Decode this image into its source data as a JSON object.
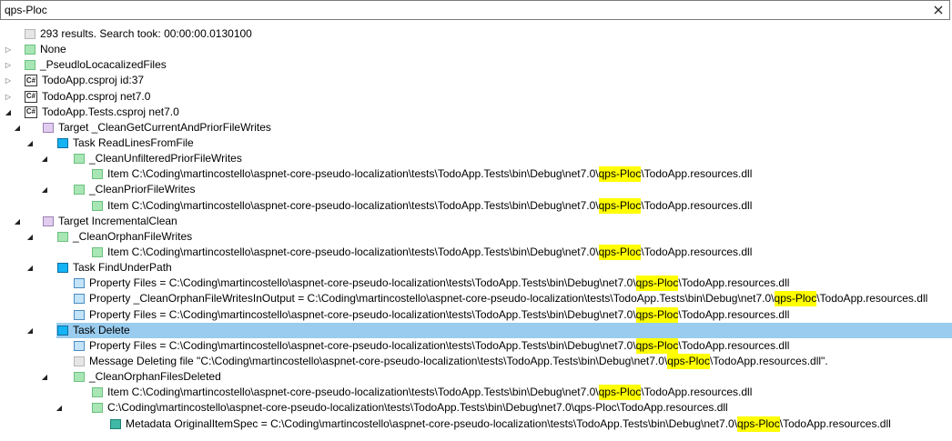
{
  "search": {
    "value": "qps-Ploc",
    "placeholder": ""
  },
  "tree": [
    {
      "level": 0,
      "toggle": "none",
      "icon": "message",
      "name": "summary-message",
      "text": "293 results. Search took: 00:00:00.0130100"
    },
    {
      "level": 0,
      "toggle": "closed",
      "icon": "folder",
      "name": "folder-none",
      "text": "None"
    },
    {
      "level": 0,
      "toggle": "closed",
      "icon": "folder",
      "name": "folder-pseudolocalized-files",
      "text": "_PseudloLocacalizedFiles"
    },
    {
      "level": 0,
      "toggle": "closed",
      "icon": "csharp",
      "name": "project-todoapp-id37",
      "text": "TodoApp.csproj id:37"
    },
    {
      "level": 0,
      "toggle": "closed",
      "icon": "csharp",
      "name": "project-todoapp-net70",
      "text": "TodoApp.csproj net7.0"
    },
    {
      "level": 0,
      "toggle": "open",
      "icon": "csharp",
      "name": "project-todoapp-tests",
      "text": "TodoApp.Tests.csproj net7.0"
    },
    {
      "level": 1,
      "toggle": "open",
      "icon": "target",
      "name": "target-clean-get-current",
      "text": "Target _CleanGetCurrentAndPriorFileWrites"
    },
    {
      "level": 2,
      "toggle": "open",
      "icon": "task",
      "name": "task-readlinesfromfile",
      "text": "Task ReadLinesFromFile"
    },
    {
      "level": 3,
      "toggle": "open",
      "icon": "folder",
      "name": "folder-clean-unfiltered",
      "text": "_CleanUnfilteredPriorFileWrites"
    },
    {
      "level": 4,
      "toggle": "none",
      "icon": "folder",
      "name": "item-resources-dll",
      "pre": "Item  C:\\Coding\\martincostello\\aspnet-core-pseudo-localization\\tests\\TodoApp.Tests\\bin\\Debug\\net7.0\\",
      "hl": "qps-Ploc",
      "post": "\\TodoApp.resources.dll"
    },
    {
      "level": 3,
      "toggle": "open",
      "icon": "folder",
      "name": "folder-clean-prior",
      "text": "_CleanPriorFileWrites"
    },
    {
      "level": 4,
      "toggle": "none",
      "icon": "folder",
      "name": "item-resources-dll",
      "pre": "Item  C:\\Coding\\martincostello\\aspnet-core-pseudo-localization\\tests\\TodoApp.Tests\\bin\\Debug\\net7.0\\",
      "hl": "qps-Ploc",
      "post": "\\TodoApp.resources.dll"
    },
    {
      "level": 1,
      "toggle": "open",
      "icon": "target",
      "name": "target-incremental-clean",
      "text": "Target IncrementalClean"
    },
    {
      "level": 2,
      "toggle": "open",
      "icon": "folder",
      "name": "folder-clean-orphan-writes",
      "text": "_CleanOrphanFileWrites"
    },
    {
      "level": 4,
      "toggle": "none",
      "icon": "folder",
      "name": "item-resources-dll",
      "pre": "Item  C:\\Coding\\martincostello\\aspnet-core-pseudo-localization\\tests\\TodoApp.Tests\\bin\\Debug\\net7.0\\",
      "hl": "qps-Ploc",
      "post": "\\TodoApp.resources.dll"
    },
    {
      "level": 2,
      "toggle": "open",
      "icon": "task",
      "name": "task-findunderpath",
      "text": "Task FindUnderPath"
    },
    {
      "level": 3,
      "toggle": "none",
      "icon": "property",
      "name": "property-files",
      "pre": "Property Files = C:\\Coding\\martincostello\\aspnet-core-pseudo-localization\\tests\\TodoApp.Tests\\bin\\Debug\\net7.0\\",
      "hl": "qps-Ploc",
      "post": "\\TodoApp.resources.dll"
    },
    {
      "level": 3,
      "toggle": "none",
      "icon": "property",
      "name": "property-clean-orphan-output",
      "pre": "Property _CleanOrphanFileWritesInOutput = C:\\Coding\\martincostello\\aspnet-core-pseudo-localization\\tests\\TodoApp.Tests\\bin\\Debug\\net7.0\\",
      "hl": "qps-Ploc",
      "post": "\\TodoApp.resources.dll"
    },
    {
      "level": 3,
      "toggle": "none",
      "icon": "property",
      "name": "property-files",
      "pre": "Property Files = C:\\Coding\\martincostello\\aspnet-core-pseudo-localization\\tests\\TodoApp.Tests\\bin\\Debug\\net7.0\\",
      "hl": "qps-Ploc",
      "post": "\\TodoApp.resources.dll"
    },
    {
      "level": 2,
      "toggle": "open",
      "icon": "task",
      "name": "task-delete",
      "text": "Task Delete",
      "selected": true
    },
    {
      "level": 3,
      "toggle": "none",
      "icon": "property",
      "name": "property-files",
      "pre": "Property Files = C:\\Coding\\martincostello\\aspnet-core-pseudo-localization\\tests\\TodoApp.Tests\\bin\\Debug\\net7.0\\",
      "hl": "qps-Ploc",
      "post": "\\TodoApp.resources.dll"
    },
    {
      "level": 3,
      "toggle": "none",
      "icon": "message",
      "name": "message-deleting-file",
      "pre": "Message  Deleting file \"C:\\Coding\\martincostello\\aspnet-core-pseudo-localization\\tests\\TodoApp.Tests\\bin\\Debug\\net7.0\\",
      "hl": "qps-Ploc",
      "post": "\\TodoApp.resources.dll\"."
    },
    {
      "level": 3,
      "toggle": "open",
      "icon": "folder",
      "name": "folder-clean-orphan-deleted",
      "text": "_CleanOrphanFilesDeleted"
    },
    {
      "level": 4,
      "toggle": "none",
      "icon": "folder",
      "name": "item-resources-dll",
      "pre": "Item  C:\\Coding\\martincostello\\aspnet-core-pseudo-localization\\tests\\TodoApp.Tests\\bin\\Debug\\net7.0\\",
      "hl": "qps-Ploc",
      "post": "\\TodoApp.resources.dll"
    },
    {
      "level": 4,
      "toggle": "open",
      "icon": "folder",
      "name": "item-path-folder",
      "text": "C:\\Coding\\martincostello\\aspnet-core-pseudo-localization\\tests\\TodoApp.Tests\\bin\\Debug\\net7.0\\qps-Ploc\\TodoApp.resources.dll"
    },
    {
      "level": 5,
      "toggle": "none",
      "icon": "metadata",
      "name": "metadata-original-item-spec",
      "pre": "Metadata OriginalItemSpec = C:\\Coding\\martincostello\\aspnet-core-pseudo-localization\\tests\\TodoApp.Tests\\bin\\Debug\\net7.0\\",
      "hl": "qps-Ploc",
      "post": "\\TodoApp.resources.dll"
    }
  ]
}
